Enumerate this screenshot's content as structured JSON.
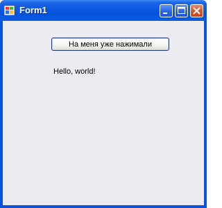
{
  "window": {
    "title": "Form1"
  },
  "titlebar_buttons": {
    "minimize": "minimize",
    "maximize": "maximize",
    "close": "close"
  },
  "form": {
    "button_label": "На меня уже нажимали",
    "label_text": "Hello, world!"
  },
  "colors": {
    "titlebar": "#0752dc",
    "client_background": "#ecebf1",
    "close_button": "#d4512d"
  }
}
